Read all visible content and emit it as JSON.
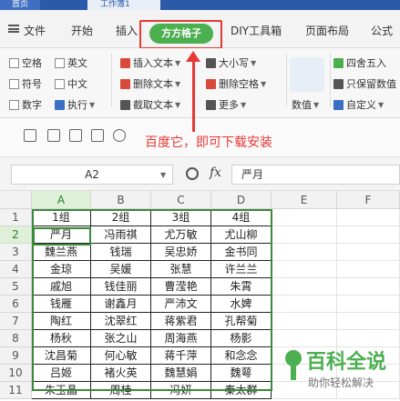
{
  "titlebar": {
    "home_tab": "首页",
    "doc_tab": "工作簿1"
  },
  "menubar": {
    "items": [
      "文件",
      "开始",
      "插入",
      "方方格子",
      "DIY工具箱",
      "页面布局",
      "公式"
    ],
    "active_tab": "方方格子",
    "active_color": "#4caf50"
  },
  "ribbon": {
    "checkboxes": [
      "空格",
      "英文",
      "符号",
      "中文",
      "数字"
    ],
    "execute_label": "执行",
    "text_tools": [
      "插入文本",
      "删除文本",
      "截取文本"
    ],
    "case_label": "大小写",
    "delete_space_label": "删除空格",
    "more_label": "更多",
    "numeric_label": "数值",
    "number_tools": [
      "四舍五入",
      "只保留数值",
      "自定义"
    ]
  },
  "annotation": {
    "text": "百度它，即可下载安装",
    "color": "#e53935"
  },
  "formula_bar": {
    "cell_ref": "A2",
    "fx_label": "fx",
    "content": "严月"
  },
  "sheet": {
    "columns": [
      "A",
      "B",
      "C",
      "D",
      "E",
      "F"
    ],
    "rows": [
      "1",
      "2",
      "3",
      "4",
      "5",
      "6",
      "7",
      "8",
      "9",
      "10",
      "11"
    ],
    "selected_column": "A",
    "selected_row": "2",
    "cells": [
      [
        "1组",
        "2组",
        "3组",
        "4组"
      ],
      [
        "严月",
        "冯雨祺",
        "尤万敏",
        "尤山柳"
      ],
      [
        "魏兰燕",
        "钱瑞",
        "吴忠娇",
        "金书同"
      ],
      [
        "金琼",
        "吴媛",
        "张慧",
        "许兰兰"
      ],
      [
        "戚旭",
        "钱佳丽",
        "曹滢艳",
        "朱霄"
      ],
      [
        "钱雁",
        "谢鑫月",
        "严沛文",
        "水婢"
      ],
      [
        "陶红",
        "沈翠红",
        "蒋紫君",
        "孔帮菊"
      ],
      [
        "杨秋",
        "张之山",
        "周海燕",
        "杨影"
      ],
      [
        "沈昌菊",
        "何心敏",
        "蒋千萍",
        "和念念"
      ],
      [
        "吕姬",
        "褚火英",
        "魏慧娟",
        "魏萼"
      ],
      [
        "朱玉晶",
        "周桂",
        "冯妍",
        "秦太群"
      ]
    ]
  },
  "watermark": {
    "title": "百科全说",
    "subtitle": "助你轻松解决"
  }
}
